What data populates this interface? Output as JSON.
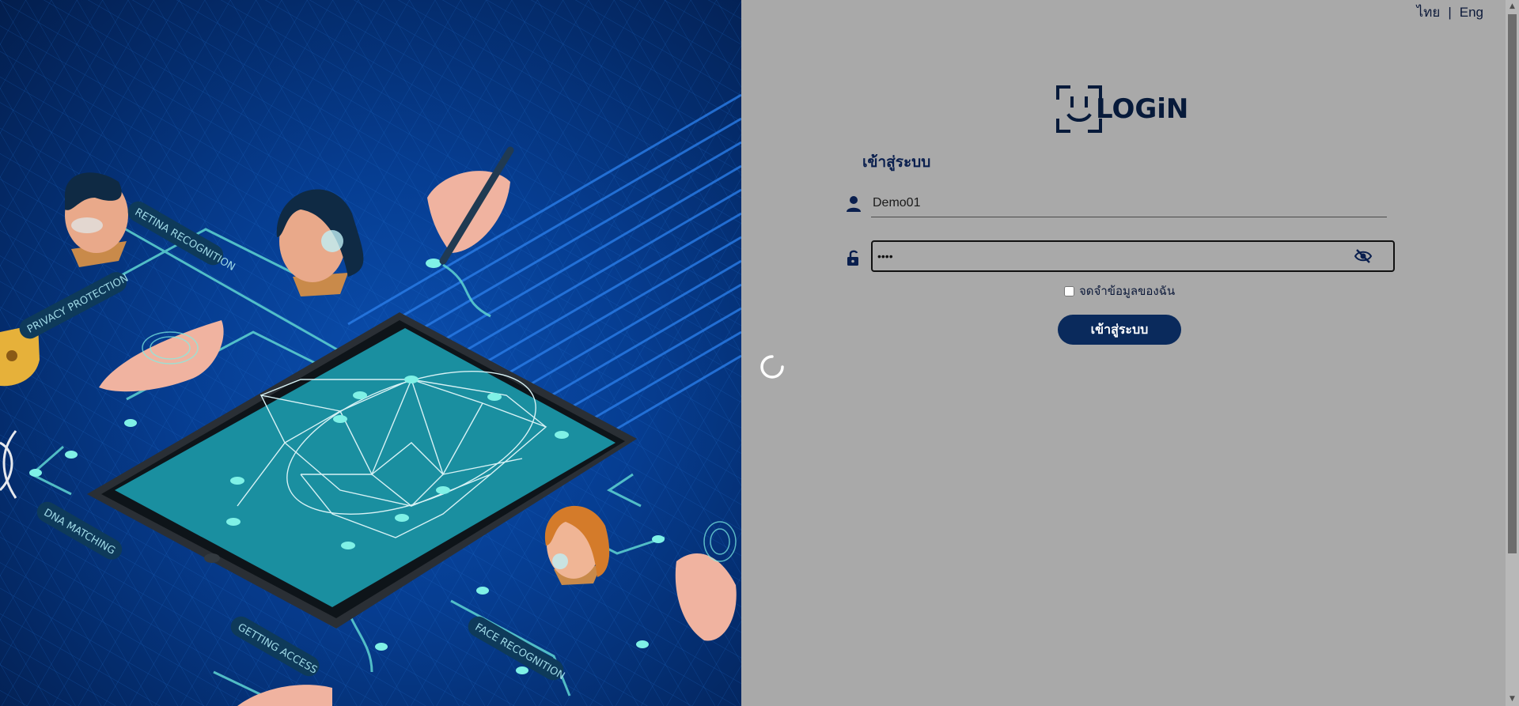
{
  "language_switch": {
    "thai": "ไทย",
    "separator": "|",
    "english": "Eng"
  },
  "logo": {
    "text": "LOGiN"
  },
  "form": {
    "title": "เข้าสู่ระบบ",
    "username_value": "Demo01",
    "password_value": "••••",
    "remember_label": "จดจำข้อมูลของฉัน",
    "submit_label": "เข้าสู่ระบบ"
  },
  "illustration": {
    "labels": [
      "RETINA RECOGNITION",
      "PRIVACY PROTECTION",
      "DNA MATCHING",
      "GETTING ACCESS",
      "FACE RECOGNITION"
    ]
  },
  "colors": {
    "primary": "#0a2a5c",
    "panel_bg": "#a9a9a9",
    "hero_bg": "#063d91",
    "accent": "#33d6c8"
  },
  "icons": [
    "user-icon",
    "lock-icon",
    "eye-off-icon",
    "loading-spinner-icon"
  ]
}
